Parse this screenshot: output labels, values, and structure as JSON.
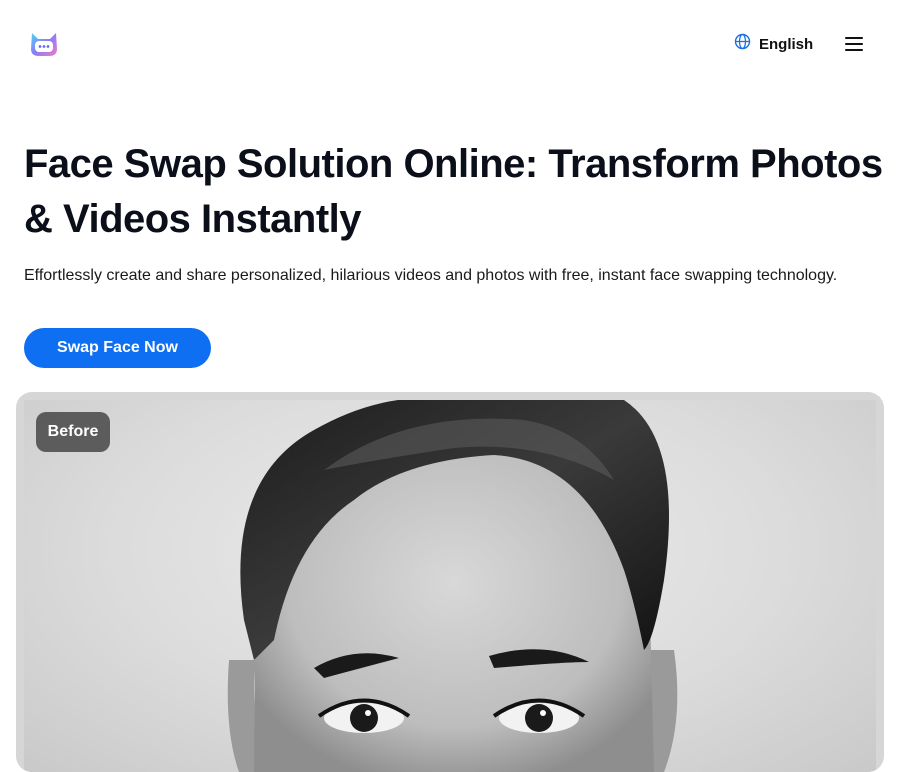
{
  "header": {
    "logo_icon": "cat-face-logo-icon",
    "language": {
      "icon": "globe-icon",
      "label": "English"
    },
    "menu_icon": "hamburger-menu-icon"
  },
  "hero": {
    "title": "Face Swap Solution Online: Transform Photos & Videos Instantly",
    "subtitle": "Effortlessly create and share personalized, hilarious videos and photos with free, instant face swapping technology.",
    "cta_label": "Swap Face Now",
    "cta_color": "#0e6ff3"
  },
  "preview": {
    "badge_label": "Before",
    "image_icon": "portrait-photo"
  }
}
